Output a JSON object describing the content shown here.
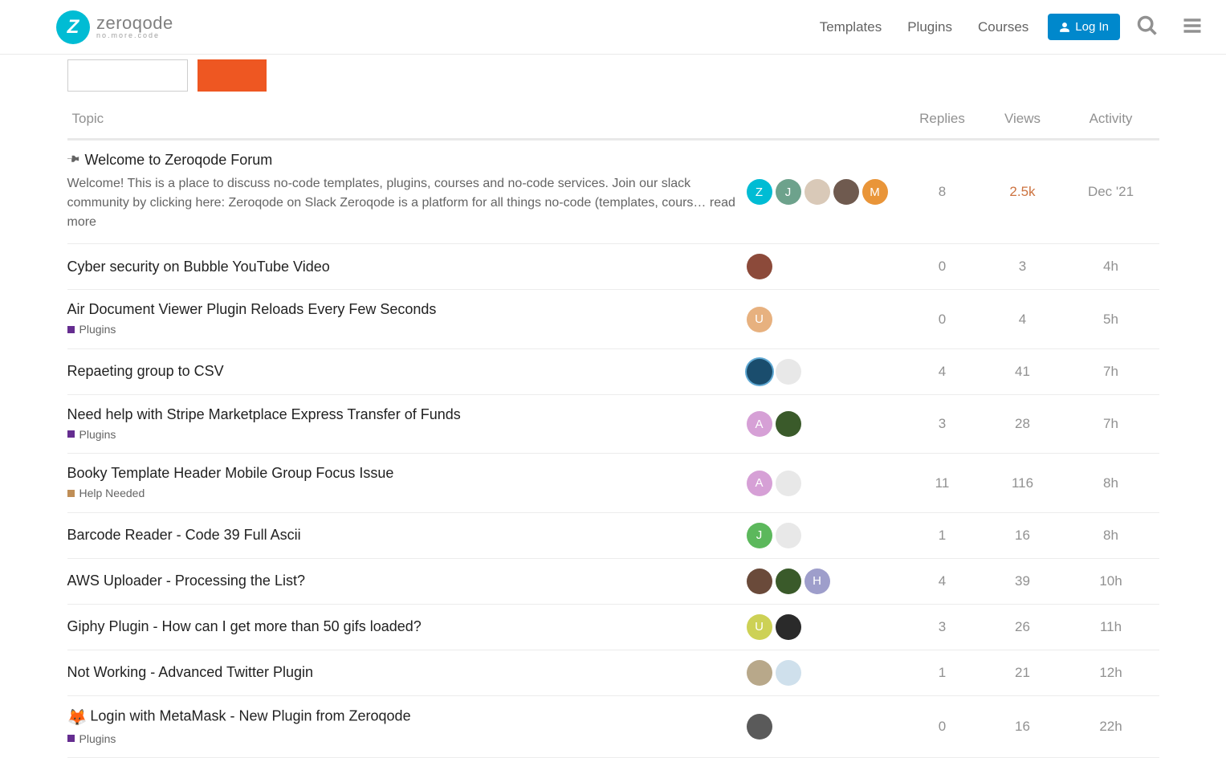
{
  "header": {
    "brand": {
      "name": "zeroqode",
      "tagline": "no.more.code"
    },
    "nav": [
      {
        "label": "Templates"
      },
      {
        "label": "Plugins"
      },
      {
        "label": "Courses"
      }
    ],
    "login_label": "Log In"
  },
  "columns": {
    "topic": "Topic",
    "replies": "Replies",
    "views": "Views",
    "activity": "Activity"
  },
  "categories": {
    "plugins": {
      "label": "Plugins",
      "color": "#652D90"
    },
    "help": {
      "label": "Help Needed",
      "color": "#BF8E56"
    }
  },
  "topics": [
    {
      "pinned": true,
      "title": "Welcome to Zeroqode Forum",
      "excerpt": "Welcome! This is a place to discuss no-code templates, plugins, courses and no-code services. Join our slack community by clicking here: Zeroqode on Slack Zeroqode is a platform for all things no-code (templates, cours… ",
      "read_more": "read more",
      "category": null,
      "avatars": [
        {
          "bg": "#00bcd4",
          "text": "Z"
        },
        {
          "bg": "#6da28c",
          "text": "J"
        },
        {
          "bg": "#d9c9b8",
          "text": ""
        },
        {
          "bg": "#6f5a4f",
          "text": ""
        },
        {
          "bg": "#e99539",
          "text": "M"
        }
      ],
      "replies": "8",
      "views": "2.5k",
      "views_heat": true,
      "activity": "Dec '21"
    },
    {
      "title": "Cyber security on Bubble YouTube Video",
      "category": null,
      "avatars": [
        {
          "bg": "#8c4a3a",
          "text": ""
        }
      ],
      "replies": "0",
      "views": "3",
      "activity": "4h"
    },
    {
      "title": "Air Document Viewer Plugin Reloads Every Few Seconds",
      "category": "plugins",
      "avatars": [
        {
          "bg": "#e7b17f",
          "text": "U"
        }
      ],
      "replies": "0",
      "views": "4",
      "activity": "5h"
    },
    {
      "title": "Repaeting group to CSV",
      "category": null,
      "avatars": [
        {
          "bg": "#1a4d6d",
          "text": "",
          "ring": "#5fa8d3"
        },
        {
          "bg": "#e8e8e8",
          "text": ""
        }
      ],
      "replies": "4",
      "views": "41",
      "activity": "7h"
    },
    {
      "title": "Need help with Stripe Marketplace Express Transfer of Funds",
      "category": "plugins",
      "avatars": [
        {
          "bg": "#d6a0d6",
          "text": "A"
        },
        {
          "bg": "#3a5a2a",
          "text": ""
        }
      ],
      "replies": "3",
      "views": "28",
      "activity": "7h"
    },
    {
      "title": "Booky Template Header Mobile Group Focus Issue",
      "category": "help",
      "avatars": [
        {
          "bg": "#d6a0d6",
          "text": "A"
        },
        {
          "bg": "#e8e8e8",
          "text": ""
        }
      ],
      "replies": "11",
      "views": "116",
      "activity": "8h"
    },
    {
      "title": "Barcode Reader - Code 39 Full Ascii",
      "category": null,
      "avatars": [
        {
          "bg": "#5cb85c",
          "text": "J"
        },
        {
          "bg": "#e8e8e8",
          "text": ""
        }
      ],
      "replies": "1",
      "views": "16",
      "activity": "8h"
    },
    {
      "title": "AWS Uploader - Processing the List?",
      "category": null,
      "avatars": [
        {
          "bg": "#6a4a3a",
          "text": ""
        },
        {
          "bg": "#3a5a2a",
          "text": ""
        },
        {
          "bg": "#9e9ecb",
          "text": "H"
        }
      ],
      "replies": "4",
      "views": "39",
      "activity": "10h"
    },
    {
      "title": "Giphy Plugin - How can I get more than 50 gifs loaded?",
      "category": null,
      "avatars": [
        {
          "bg": "#cdd155",
          "text": "U"
        },
        {
          "bg": "#2a2a2a",
          "text": ""
        }
      ],
      "replies": "3",
      "views": "26",
      "activity": "11h"
    },
    {
      "title": "Not Working - Advanced Twitter Plugin",
      "category": null,
      "avatars": [
        {
          "bg": "#b8a88a",
          "text": ""
        },
        {
          "bg": "#cfe0ec",
          "text": ""
        }
      ],
      "replies": "1",
      "views": "21",
      "activity": "12h"
    },
    {
      "emoji": "🦊",
      "title": "Login with MetaMask - New Plugin from Zeroqode",
      "category": "plugins",
      "avatars": [
        {
          "bg": "#5a5a5a",
          "text": ""
        }
      ],
      "replies": "0",
      "views": "16",
      "activity": "22h"
    }
  ]
}
